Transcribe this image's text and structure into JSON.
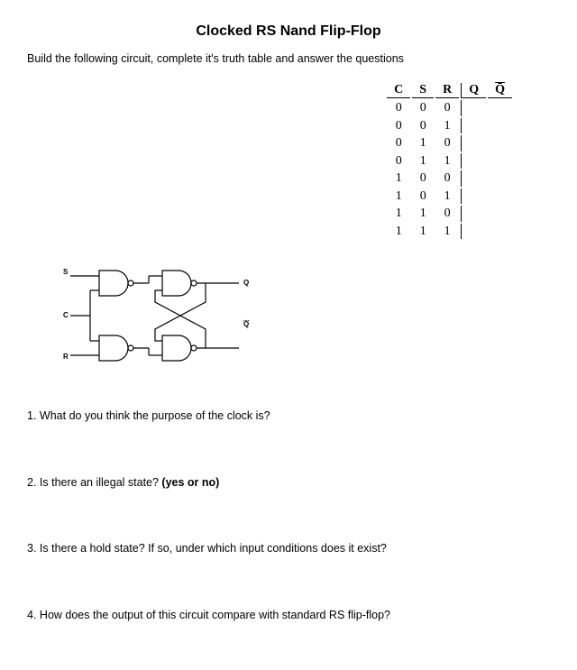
{
  "title": "Clocked RS Nand Flip-Flop",
  "instructions": "Build the following circuit, complete it's truth table and answer the questions",
  "truth_table": {
    "headers": [
      "C",
      "S",
      "R",
      "Q",
      "Q̄"
    ],
    "rows": [
      [
        "0",
        "0",
        "0",
        "",
        ""
      ],
      [
        "0",
        "0",
        "1",
        "",
        ""
      ],
      [
        "0",
        "1",
        "0",
        "",
        ""
      ],
      [
        "0",
        "1",
        "1",
        "",
        ""
      ],
      [
        "1",
        "0",
        "0",
        "",
        ""
      ],
      [
        "1",
        "0",
        "1",
        "",
        ""
      ],
      [
        "1",
        "1",
        "0",
        "",
        ""
      ],
      [
        "1",
        "1",
        "1",
        "",
        ""
      ]
    ]
  },
  "circuit": {
    "input_labels": {
      "s": "S",
      "c": "C",
      "r": "R"
    },
    "output_labels": {
      "q": "Q",
      "qbar": "Q̄"
    }
  },
  "questions": [
    {
      "num": "1.",
      "text": "What do you think the purpose of the clock is?"
    },
    {
      "num": "2.",
      "text_pre": "Is there an illegal state? ",
      "text_bold": "(yes or no)"
    },
    {
      "num": "3.",
      "text": "Is there a hold state? If so, under which input conditions does it exist?"
    },
    {
      "num": "4.",
      "text": "How does the output of this circuit compare with standard RS flip-flop?"
    }
  ]
}
